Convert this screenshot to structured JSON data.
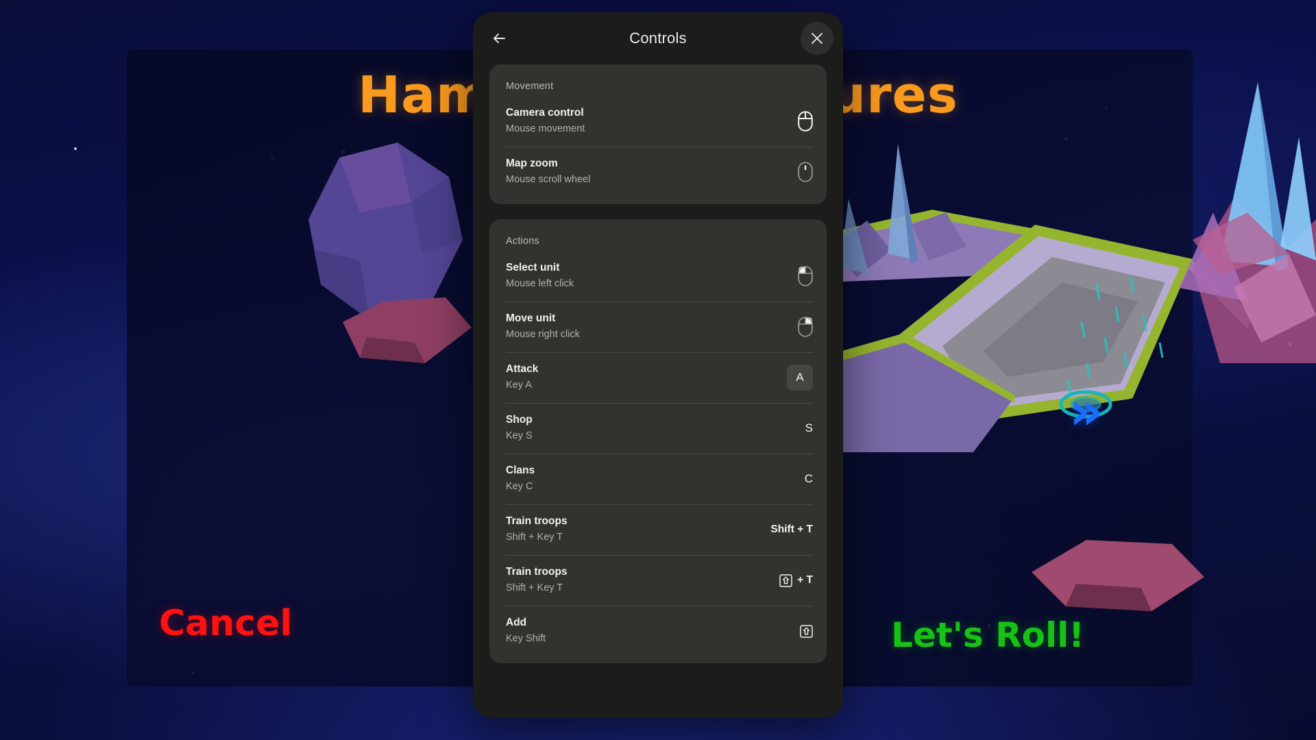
{
  "background": {
    "game_title": "Hammer Adventures",
    "buttons": [
      {
        "label": "Cancel",
        "color": "#ff1111"
      },
      {
        "label": "Let's Roll!",
        "color": "#16c216"
      }
    ],
    "chevrons": "»",
    "colors": {
      "title": "#fa9a1e",
      "cancel": "#ff1111",
      "roll": "#16c216",
      "chevron": "#1a6dff",
      "space": "#0a0f45"
    }
  },
  "dialog": {
    "title": "Controls",
    "back_icon": "arrow-left-icon",
    "close_icon": "close-icon",
    "colors": {
      "surface": "#1c1c1a",
      "card": "#32332f",
      "divider": "#4a4b46",
      "text_primary": "#f2f3ef",
      "text_secondary": "#b0b2ac"
    },
    "sections": [
      {
        "title": "Movement",
        "rows": [
          {
            "title": "Camera control",
            "subtitle": "Mouse movement",
            "accessory_type": "mouse",
            "accessory_label": "mouse-move-icon"
          },
          {
            "title": "Map zoom",
            "subtitle": "Mouse scroll wheel",
            "accessory_type": "mouse-scroll",
            "accessory_label": "mouse-scroll-icon"
          }
        ]
      },
      {
        "title": "Actions",
        "rows": [
          {
            "title": "Select unit",
            "subtitle": "Mouse left click",
            "accessory_type": "mouse-left",
            "accessory_label": "mouse-left-click-icon"
          },
          {
            "title": "Move unit",
            "subtitle": "Mouse right click",
            "accessory_type": "mouse-right",
            "accessory_label": "mouse-right-click-icon"
          },
          {
            "title": "Attack",
            "subtitle": "Key A",
            "accessory_type": "key-boxed",
            "accessory_label": "A"
          },
          {
            "title": "Shop",
            "subtitle": "Key S",
            "accessory_type": "key",
            "accessory_label": "S"
          },
          {
            "title": "Clans",
            "subtitle": "Key C",
            "accessory_type": "key",
            "accessory_label": "C"
          },
          {
            "title": "Train troops",
            "subtitle": "Shift + Key T",
            "accessory_type": "combo-text",
            "accessory_label": "Shift + T"
          },
          {
            "title": "Train troops",
            "subtitle": "Shift + Key T",
            "accessory_type": "combo-icon",
            "accessory_label": "+ T"
          },
          {
            "title": "Add",
            "subtitle": "Key Shift",
            "accessory_type": "shift-icon",
            "accessory_label": "shift-key-icon"
          }
        ]
      }
    ]
  }
}
